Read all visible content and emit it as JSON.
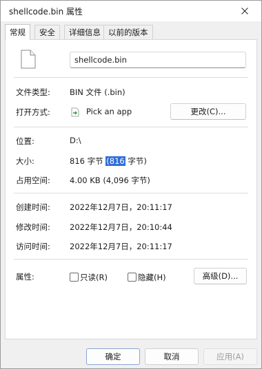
{
  "window": {
    "title": "shellcode.bin 属性",
    "close_icon": "close-icon"
  },
  "tabs": [
    {
      "label": "常规",
      "active": true
    },
    {
      "label": "安全",
      "active": false
    },
    {
      "label": "详细信息",
      "active": false
    },
    {
      "label": "以前的版本",
      "active": false
    }
  ],
  "general": {
    "file_name": "shellcode.bin",
    "file_type_label": "文件类型:",
    "file_type_value": "BIN 文件 (.bin)",
    "open_with_label": "打开方式:",
    "open_with_value": "Pick an app",
    "change_button": "更改(C)...",
    "location_label": "位置:",
    "location_value": "D:\\",
    "size_label": "大小:",
    "size_value_prefix": "816 字节 ",
    "size_value_selected": "(816",
    "size_value_suffix": " 字节)",
    "size_on_disk_label": "占用空间:",
    "size_on_disk_value": "4.00 KB (4,096 字节)",
    "created_label": "创建时间:",
    "created_value": "2022年12月7日，20:11:17",
    "modified_label": "修改时间:",
    "modified_value": "2022年12月7日，20:10:44",
    "accessed_label": "访问时间:",
    "accessed_value": "2022年12月7日，20:11:17",
    "attributes_label": "属性:",
    "readonly_label": "只读(R)",
    "hidden_label": "隐藏(H)",
    "advanced_button": "高级(D)..."
  },
  "footer": {
    "ok": "确定",
    "cancel": "取消",
    "apply": "应用(A)"
  },
  "colors": {
    "selection": "#2f6dd8",
    "panel_bg": "#ffffff",
    "window_bg": "#f0f0f0"
  }
}
